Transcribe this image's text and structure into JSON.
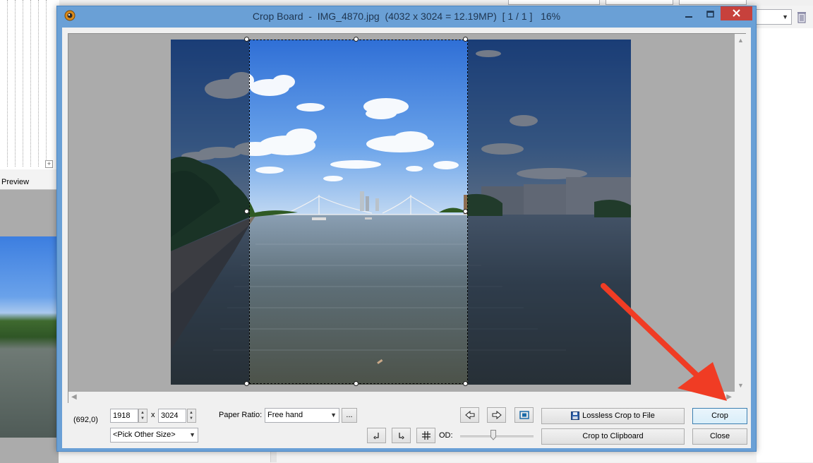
{
  "background_app": {
    "preview_label": "Preview",
    "tree_expander": "+"
  },
  "dialog": {
    "title": "Crop Board  -  IMG_4870.jpg  (4032 x 3024 = 12.19MP)  [ 1 / 1 ]   16%",
    "icons": {
      "app": "camera-lens-icon",
      "minimize": "minimize-icon",
      "maximize": "maximize-icon",
      "close": "close-icon"
    }
  },
  "crop": {
    "coords": "(692,0)",
    "width": "1918",
    "x_sep": "x",
    "height": "3024",
    "paper_ratio_label": "Paper Ratio:",
    "paper_ratio_value": "Free hand",
    "more_label": "...",
    "pick_size": "<Pick Other Size>",
    "od_label": "OD:",
    "od_level": 0.45
  },
  "buttons": {
    "lossless": "Lossless Crop to File",
    "crop": "Crop",
    "clipboard": "Crop to Clipboard",
    "close": "Close"
  },
  "icon_buttons": {
    "prev": "arrow-left-icon",
    "next": "arrow-right-icon",
    "fit": "fit-screen-icon",
    "rotate_left": "rotate-left-icon",
    "rotate_right": "rotate-right-icon",
    "grid": "grid-icon"
  },
  "colors": {
    "accent": "#6aa0d6",
    "close_red": "#c7413c",
    "annotation_arrow": "#f03c24"
  }
}
